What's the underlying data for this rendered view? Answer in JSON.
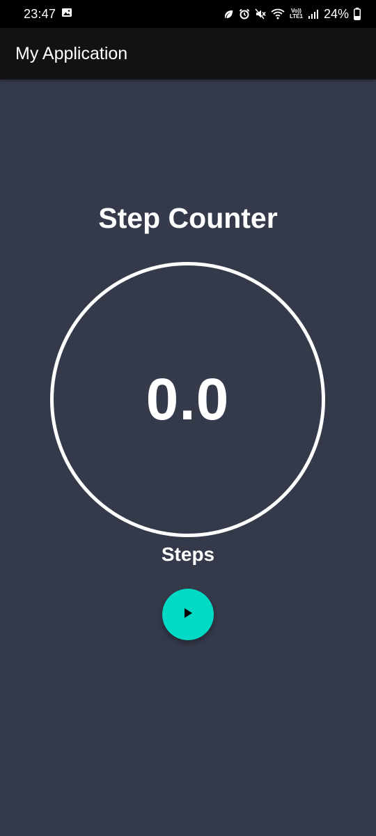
{
  "status_bar": {
    "time": "23:47",
    "battery_percent": "24%",
    "network_top": "Vo))",
    "network_bottom": "LTE1",
    "icons": [
      "image-icon",
      "leaf-icon",
      "alarm-icon",
      "mute-icon",
      "wifi-icon",
      "signal-icon",
      "battery-icon"
    ]
  },
  "app_bar": {
    "title": "My Application"
  },
  "main": {
    "heading": "Step Counter",
    "count": "0.0",
    "unit_label": "Steps",
    "play_button_icon": "play-icon"
  },
  "colors": {
    "background": "#353a4b",
    "app_bar": "#121212",
    "accent": "#03dac6",
    "text": "#ffffff"
  }
}
